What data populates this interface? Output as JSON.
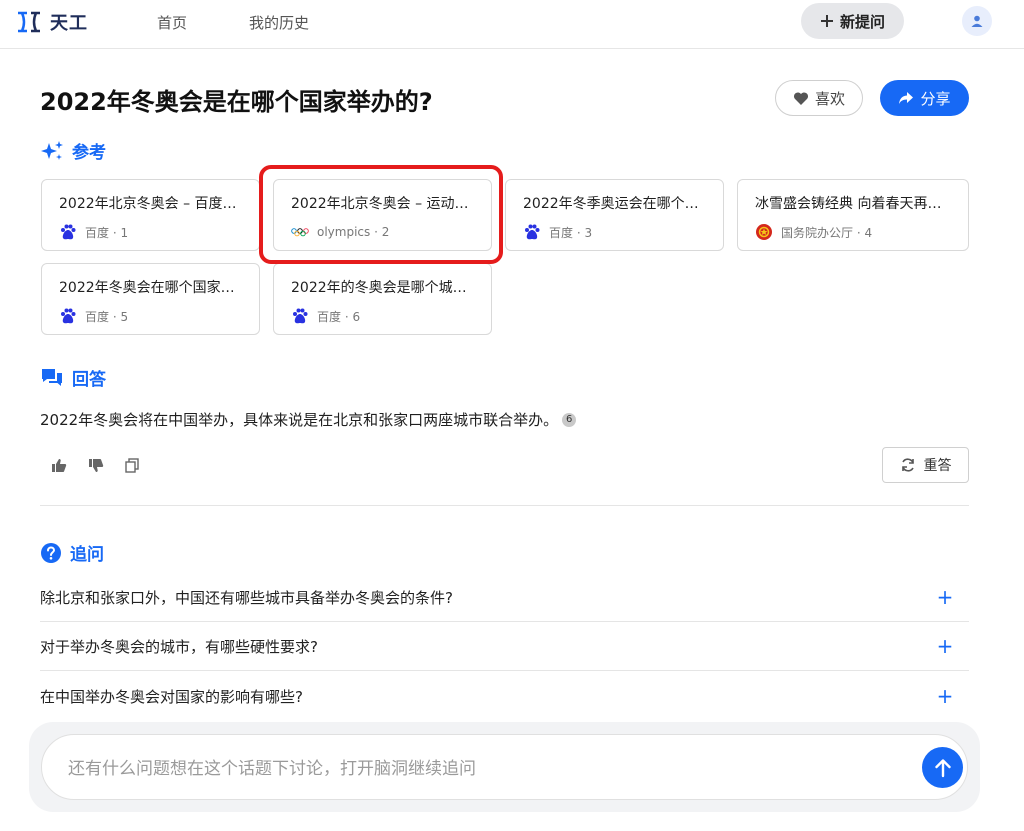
{
  "app": {
    "name": "天工",
    "nav": [
      {
        "label": "首页"
      },
      {
        "label": "我的历史"
      }
    ],
    "new_question_label": "新提问"
  },
  "question": {
    "title": "2022年冬奥会是在哪个国家举办的?",
    "like_label": "喜欢",
    "share_label": "分享"
  },
  "references": {
    "heading": "参考",
    "cards": [
      {
        "title": "2022年北京冬奥会 – 百度…",
        "source": "百度 · 1",
        "icon": "baidu-icon"
      },
      {
        "title": "2022年北京冬奥会 – 运动…",
        "source": "olympics · 2",
        "icon": "olympic-rings-icon"
      },
      {
        "title": "2022年冬季奥运会在哪个…",
        "source": "百度 · 3",
        "icon": "baidu-icon"
      },
      {
        "title": "冰雪盛会铸经典 向着春天再…",
        "source": "国务院办公厅 · 4",
        "icon": "national-emblem-icon"
      },
      {
        "title": "2022年冬奥会在哪个国家…",
        "source": "百度 · 5",
        "icon": "baidu-icon"
      },
      {
        "title": "2022年的冬奥会是哪个城…",
        "source": "百度 · 6",
        "icon": "baidu-icon"
      }
    ]
  },
  "answer": {
    "heading": "回答",
    "text": "2022年冬奥会将在中国举办，具体来说是在北京和张家口两座城市联合举办。",
    "citation": "6",
    "regenerate_label": "重答"
  },
  "followup": {
    "heading": "追问",
    "items": [
      {
        "text": "除北京和张家口外，中国还有哪些城市具备举办冬奥会的条件?"
      },
      {
        "text": "对于举办冬奥会的城市，有哪些硬性要求?"
      },
      {
        "text": "在中国举办冬奥会对国家的影响有哪些?"
      }
    ]
  },
  "input": {
    "placeholder": "还有什么问题想在这个话题下讨论，打开脑洞继续追问"
  },
  "colors": {
    "accent": "#1769f5",
    "highlight": "#e51c1c"
  }
}
